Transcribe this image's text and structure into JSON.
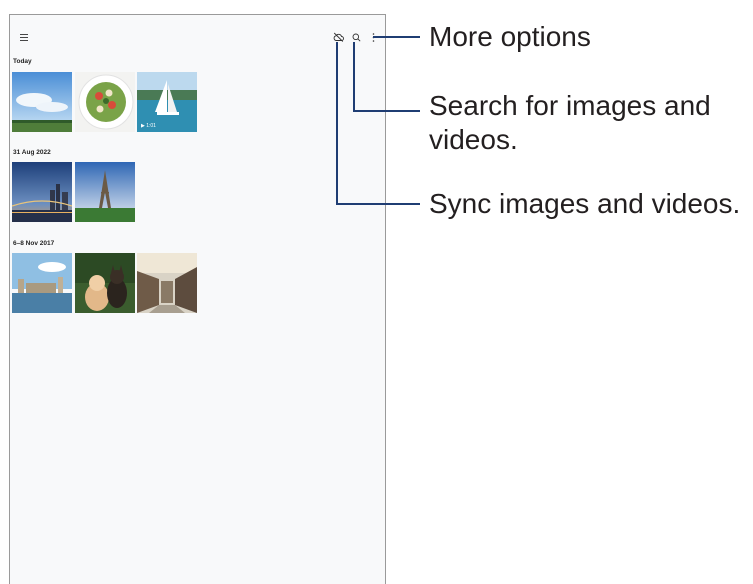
{
  "screen": {
    "icons": {
      "menu": "menu-icon",
      "sync": "cloud-sync-off-icon",
      "search": "search-icon",
      "more": "more-vertical-icon"
    },
    "sections": [
      {
        "title": "Today",
        "items": [
          {
            "subject": "sky-landscape",
            "video_duration": ""
          },
          {
            "subject": "salad-bowl",
            "video_duration": ""
          },
          {
            "subject": "sailboat-sea",
            "video_duration": "1:01"
          }
        ]
      },
      {
        "title": "31 Aug 2022",
        "items": [
          {
            "subject": "city-bridge-dusk",
            "video_duration": ""
          },
          {
            "subject": "eiffel-tower",
            "video_duration": ""
          }
        ]
      },
      {
        "title": "6–8 Nov 2017",
        "items": [
          {
            "subject": "river-city",
            "video_duration": ""
          },
          {
            "subject": "cat-and-dog",
            "video_duration": ""
          },
          {
            "subject": "village-street",
            "video_duration": ""
          }
        ]
      }
    ]
  },
  "callouts": {
    "more_options": "More options",
    "search_line1": "Search for images and",
    "search_line2": "videos.",
    "sync": "Sync images and videos."
  },
  "colors": {
    "callout_line": "#1f3d73",
    "screen_bg": "#f8f9fa"
  }
}
